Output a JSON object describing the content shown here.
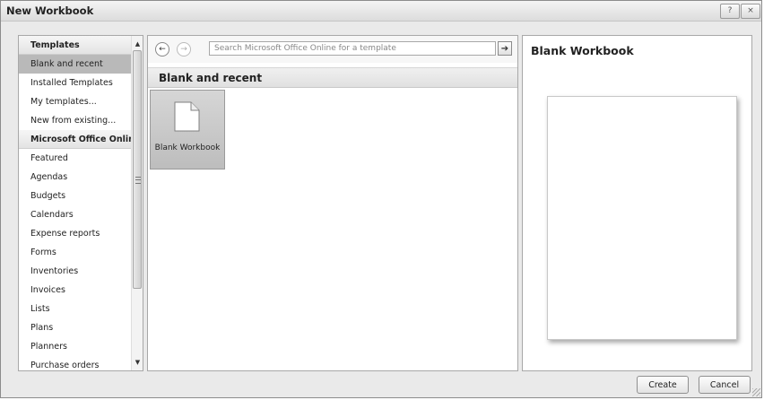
{
  "window": {
    "title": "New Workbook",
    "help_icon": "?",
    "close_icon": "×"
  },
  "left_nav": {
    "items": [
      {
        "label": "Templates",
        "type": "header"
      },
      {
        "label": "Blank and recent",
        "type": "item",
        "selected": true
      },
      {
        "label": "Installed Templates",
        "type": "item"
      },
      {
        "label": "My templates...",
        "type": "item"
      },
      {
        "label": "New from existing...",
        "type": "item"
      },
      {
        "label": "Microsoft Office Online",
        "type": "header"
      },
      {
        "label": "Featured",
        "type": "item"
      },
      {
        "label": "Agendas",
        "type": "item"
      },
      {
        "label": "Budgets",
        "type": "item"
      },
      {
        "label": "Calendars",
        "type": "item"
      },
      {
        "label": "Expense reports",
        "type": "item"
      },
      {
        "label": "Forms",
        "type": "item"
      },
      {
        "label": "Inventories",
        "type": "item"
      },
      {
        "label": "Invoices",
        "type": "item"
      },
      {
        "label": "Lists",
        "type": "item"
      },
      {
        "label": "Plans",
        "type": "item"
      },
      {
        "label": "Planners",
        "type": "item"
      },
      {
        "label": "Purchase orders",
        "type": "item"
      }
    ],
    "scroll_up": "▲",
    "scroll_down": "▼"
  },
  "middle": {
    "back": "←",
    "forward": "→",
    "search_placeholder": "Search Microsoft Office Online for a template",
    "go": "➔",
    "section_title": "Blank and recent",
    "tile_label": "Blank Workbook"
  },
  "right": {
    "title": "Blank Workbook"
  },
  "footer": {
    "create_label": "Create",
    "cancel_label": "Cancel"
  }
}
